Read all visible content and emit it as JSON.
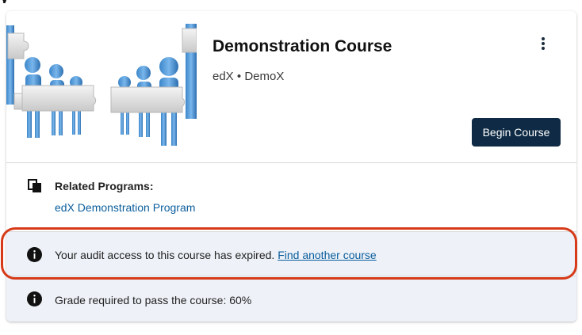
{
  "course": {
    "title": "Demonstration Course",
    "org": "edX",
    "separator": "•",
    "number": "DemoX",
    "begin_label": "Begin Course",
    "image_icon": "puzzle-people-image"
  },
  "menu": {
    "icon": "kebab-menu-icon"
  },
  "related": {
    "label": "Related Programs:",
    "program_link": "edX Demonstration Program",
    "icon": "programs-icon"
  },
  "alerts": {
    "expired_text": "Your audit access to this course has expired.",
    "expired_link": "Find another course",
    "grade_text": "Grade required to pass the course: 60%",
    "icon": "info-icon"
  },
  "colors": {
    "primary_button": "#0e2a44",
    "link": "#0a5d9c",
    "alert_bg": "#eef2f8",
    "highlight": "#d63a18"
  }
}
